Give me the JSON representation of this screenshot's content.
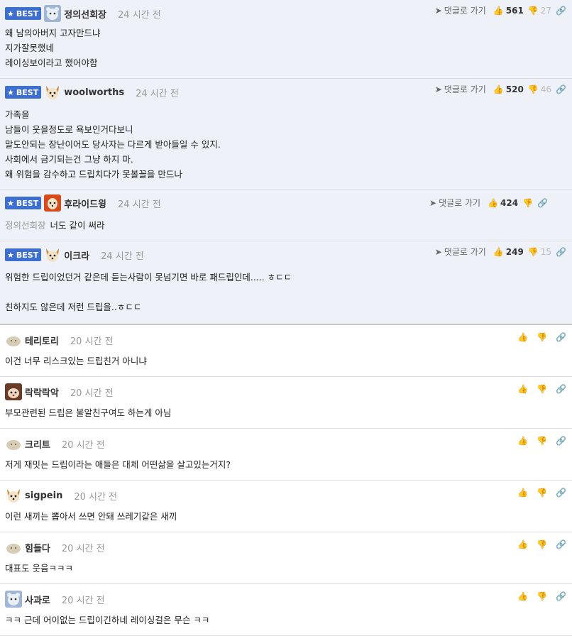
{
  "labels": {
    "best": "BEST",
    "reply_link": "댓글로 가기"
  },
  "colors": {
    "best_badge": "#3d6fd0",
    "best_bg": "#eef1f7",
    "time": "#999999"
  },
  "best_comments": [
    {
      "nick": "정의선회장",
      "time": "24 시간 전",
      "avatar": "bear-avatar",
      "lines": "왜 남의아버지 고자만드냐\n지가잘못했네\n레이싱보이라고 했어야함",
      "up": "561",
      "down": "27"
    },
    {
      "nick": "woolworths",
      "time": "24 시간 전",
      "avatar": "dog-avatar",
      "lines": "가족을\n남들이 웃을정도로 욕보인거다보니\n말도안되는 장난이어도 당사자는 다르게 받아들일 수 있지.\n사회에서 금기되는건 그냥 하지 마.\n왜 위험을 감수하고 드립치다가 못볼꼴을 만드나",
      "up": "520",
      "down": "46"
    },
    {
      "nick": "후라이드윙",
      "time": "24 시간 전",
      "avatar": "fire-dog-avatar",
      "mention": "정의선회장",
      "lines": "너도 같이 써라",
      "up": "424",
      "down": ""
    },
    {
      "nick": "이크라",
      "time": "24 시간 전",
      "avatar": "dog-avatar",
      "lines": "위험한 드립이었던거 같은데 듣는사람이 못넘기면 바로 패드립인데..... ㅎㄷㄷ\n\n친하지도 않은데 저런 드립을..ㅎㄷㄷ",
      "up": "249",
      "down": "15"
    }
  ],
  "comments": [
    {
      "nick": "테리토리",
      "time": "20 시간 전",
      "avatar": "blob-avatar",
      "text": "이건 너무 리스크있는 드립친거 아니냐"
    },
    {
      "nick": "락락락악",
      "time": "20 시간 전",
      "avatar": "pug-avatar",
      "text": "부모관련된 드립은 불알친구여도 하는게 아님"
    },
    {
      "nick": "크리트",
      "time": "20 시간 전",
      "avatar": "blob-avatar",
      "text": "저게 재밋는 드립이라는 애들은 대체 어떤삶을 살고있는거지?"
    },
    {
      "nick": "sigpein",
      "time": "20 시간 전",
      "avatar": "dog-avatar",
      "text": "이런 새끼는 뽑아서 쓰면 안돼 쓰레기같은 새끼"
    },
    {
      "nick": "힘들다",
      "time": "20 시간 전",
      "avatar": "blob-avatar",
      "text": "대표도 웃음ㅋㅋㅋ"
    },
    {
      "nick": "사과로",
      "time": "20 시간 전",
      "avatar": "bear-avatar",
      "text": "ㅋㅋ 근데 어이없는 드립이긴하네 레이싱걸은 무슨 ㅋㅋ"
    }
  ]
}
